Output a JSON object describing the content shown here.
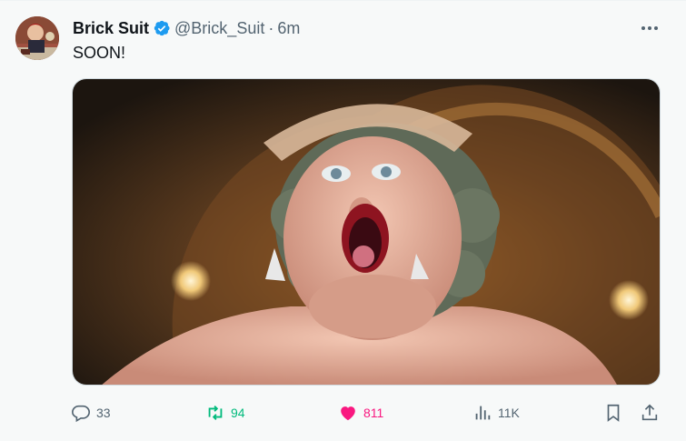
{
  "author": {
    "name": "Brick Suit",
    "handle": "@Brick_Suit",
    "separator": "·",
    "time": "6m",
    "verified": true
  },
  "tweet": {
    "text": "SOON!"
  },
  "media": {
    "icon": "photo-icon"
  },
  "actions": {
    "reply_count": "33",
    "retweet_count": "94",
    "like_count": "811",
    "views_count": "11K"
  },
  "colors": {
    "verified_blue": "#1d9bf0",
    "retweet_green": "#00ba7c",
    "like_pink": "#f91880",
    "muted": "#536471"
  }
}
